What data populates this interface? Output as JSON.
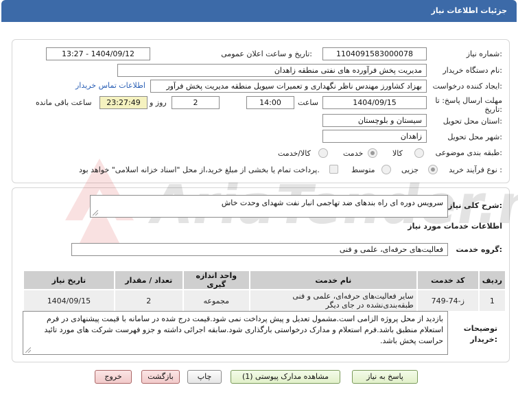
{
  "header": {
    "title": "جزئیات اطلاعات نیاز"
  },
  "details": {
    "need_number_label": "شماره نیاز:",
    "need_number": "1104091583000078",
    "announce_label": "تاریخ و ساعت اعلان عمومی:",
    "announce_value": "1404/09/12 - 13:27",
    "buyer_org_label": "نام دستگاه خریدار:",
    "buyer_org": "مدیریت پخش فرآورده های نفتی منطقه زاهدان",
    "creator_label": "ایجاد کننده درخواست:",
    "creator": "بهزاد کشاورز مهندس ناظر نگهداری و تعمیرات سیویل منطقه  مدیریت پخش فرآور",
    "contact_link": "اطلاعات تماس خریدار",
    "deadline_label_1": "مهلت ارسال پاسخ: تا",
    "deadline_label_2": "تاریخ:",
    "deadline_date": "1404/09/15",
    "time_label": "ساعت",
    "deadline_time": "14:00",
    "days_value": "2",
    "days_label": "روز و",
    "remaining_time": "23:27:49",
    "remaining_label": "ساعت باقی مانده",
    "province_label": "استان محل تحویل:",
    "province": "سیستان و بلوچستان",
    "city_label": "شهر محل تحویل:",
    "city": "زاهدان",
    "category_label": "طبقه بندی موضوعی:",
    "category_options": [
      "کالا",
      "خدمت",
      "کالا/خدمت"
    ],
    "category_selected": "خدمت",
    "process_label": "نوع فرآیند خرید :",
    "process_options": [
      "جزیی",
      "متوسط"
    ],
    "process_selected": "جزیی",
    "payment_note": "پرداخت تمام یا بخشی از مبلغ خرید،از محل \"اسناد خزانه اسلامی\" خواهد بود."
  },
  "summary": {
    "label": "شرح کلی نیاز:",
    "value": "سرویس  دوره ای راه بندهای ضد تهاجمی انبار نفت شهدای وحدت خاش"
  },
  "services": {
    "section_title": "اطلاعات خدمات مورد نیاز",
    "group_label": "گروه خدمت:",
    "group_value": "فعالیت‌های حرفه‌ای، علمی و فنی",
    "columns": [
      "ردیف",
      "کد خدمت",
      "نام خدمت",
      "واحد اندازه گیری",
      "تعداد / مقدار",
      "تاریخ نیاز"
    ],
    "rows": [
      [
        "1",
        "ز-74-749",
        "سایر فعالیت‌های حرفه‌ای، علمی و فنی طبقه‌بندی‌نشده در جای دیگر",
        "مجموعه",
        "2",
        "1404/09/15"
      ]
    ]
  },
  "buyer_notes": {
    "label_1": "توضیحات",
    "label_2": "خریدار:",
    "text": "بازدید از محل پروژه الزامی است.مشمول تعدیل و پیش پرداخت نمی شود.قیمت درج شده در سامانه با قیمت پیشنهادی در فرم استعلام منطبق باشد.فرم استعلام و مدارک درخواستی بارگذاری شود.سابقه اجرائی داشته و جزو فهرست شرکت های مورد تائید حراست پخش باشد."
  },
  "buttons": {
    "reply": "پاسخ به نیاز",
    "view_docs": "مشاهده مدارک پیوستی (1)",
    "print": "چاپ",
    "back": "بازگشت",
    "exit": "خروج"
  },
  "watermark": {
    "text": "AriaTender.neT"
  },
  "colors": {
    "header": "#3c6aa8",
    "link": "#2a5fb5",
    "remaining_bg": "#f5f2c0",
    "table_head": "#cfcfcf"
  }
}
